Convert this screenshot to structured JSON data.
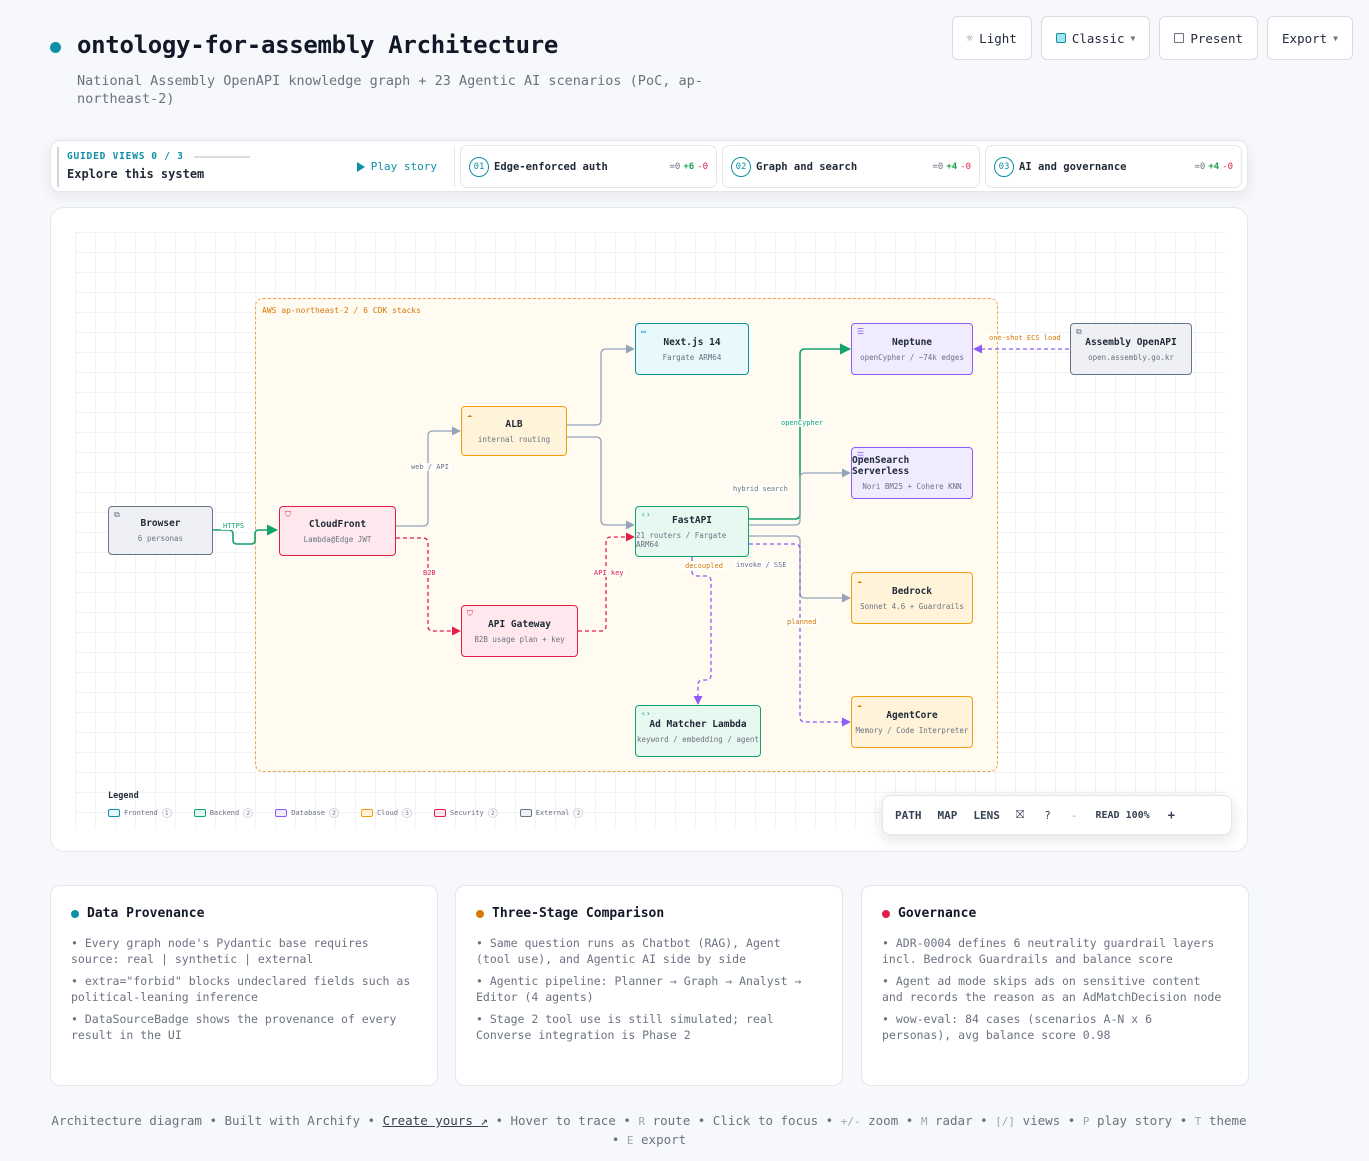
{
  "header": {
    "title": "ontology-for-assembly Architecture",
    "subtitle": "National Assembly OpenAPI knowledge graph + 23 Agentic AI scenarios (PoC, ap-northeast-2)"
  },
  "topbar": {
    "light_label": "Light",
    "classic_label": "Classic",
    "present_label": "Present",
    "export_label": "Export"
  },
  "guided": {
    "kicker": "GUIDED VIEWS",
    "progress": "0 / 3",
    "explore": "Explore this system",
    "play_label": "Play story",
    "views": [
      {
        "num": "01",
        "name": "Edge-enforced auth",
        "eq": "=0",
        "plus": "+6",
        "minus": "-0"
      },
      {
        "num": "02",
        "name": "Graph and search",
        "eq": "=0",
        "plus": "+4",
        "minus": "-0"
      },
      {
        "num": "03",
        "name": "AI and governance",
        "eq": "=0",
        "plus": "+4",
        "minus": "-0"
      }
    ]
  },
  "diagram": {
    "region_label": "AWS ap-northeast-2 / 6 CDK stacks",
    "nodes": {
      "browser": {
        "title": "Browser",
        "sub": "6 personas"
      },
      "cloudfront": {
        "title": "CloudFront",
        "sub": "Lambda@Edge JWT"
      },
      "alb": {
        "title": "ALB",
        "sub": "internal routing"
      },
      "apigw": {
        "title": "API Gateway",
        "sub": "B2B usage plan + key"
      },
      "nextjs": {
        "title": "Next.js 14",
        "sub": "Fargate ARM64"
      },
      "fastapi": {
        "title": "FastAPI",
        "sub": "21 routers / Fargate ARM64"
      },
      "admatcher": {
        "title": "Ad Matcher Lambda",
        "sub": "keyword / embedding / agent"
      },
      "neptune": {
        "title": "Neptune",
        "sub": "openCypher / ~74k edges"
      },
      "opensearch": {
        "title": "OpenSearch Serverless",
        "sub": "Nori BM25 + Cohere KNN"
      },
      "bedrock": {
        "title": "Bedrock",
        "sub": "Sonnet 4.6 + Guardrails"
      },
      "agentcore": {
        "title": "AgentCore",
        "sub": "Memory / Code Interpreter"
      },
      "assembly": {
        "title": "Assembly OpenAPI",
        "sub": "open.assembly.go.kr"
      }
    },
    "edge_labels": {
      "https": "HTTPS",
      "web_api": "web / API",
      "b2b": "B2B",
      "api_key": "API key",
      "opencypher": "openCypher",
      "hybrid_search": "hybrid search",
      "invoke_sse": "invoke / SSE",
      "decoupled": "decoupled",
      "planned": "planned",
      "one_shot": "one-shot ECS load"
    },
    "legend": {
      "title": "Legend",
      "items": [
        {
          "label": "Frontend",
          "count": "1"
        },
        {
          "label": "Backend",
          "count": "2"
        },
        {
          "label": "Database",
          "count": "2"
        },
        {
          "label": "Cloud",
          "count": "3"
        },
        {
          "label": "Security",
          "count": "2"
        },
        {
          "label": "External",
          "count": "2"
        }
      ]
    },
    "colors": {
      "frontend": "#0e8fa6",
      "backend": "#10a36d",
      "database": "#8b5cf6",
      "cloud": "#f59e0b",
      "security": "#e11d48",
      "external": "#64748b"
    }
  },
  "toolbar": {
    "path": "PATH",
    "map": "MAP",
    "lens": "LENS",
    "help": "?",
    "minus": "-",
    "read": "READ 100%",
    "plus": "+"
  },
  "cards": [
    {
      "title": "Data Provenance",
      "color": "#0e8fa6",
      "items": [
        "• Every graph node's Pydantic base requires source: real | synthetic | external",
        "• extra=\"forbid\" blocks undeclared fields such as political-leaning inference",
        "• DataSourceBadge shows the provenance of every result in the UI"
      ]
    },
    {
      "title": "Three-Stage Comparison",
      "color": "#d97706",
      "items": [
        "• Same question runs as Chatbot (RAG), Agent (tool use), and Agentic AI side by side",
        "• Agentic pipeline: Planner → Graph → Analyst → Editor (4 agents)",
        "• Stage 2 tool use is still simulated; real Converse integration is Phase 2"
      ]
    },
    {
      "title": "Governance",
      "color": "#e11d48",
      "items": [
        "• ADR-0004 defines 6 neutrality guardrail layers incl. Bedrock Guardrails and balance score",
        "• Agent ad mode skips ads on sensitive content and records the reason as an AdMatchDecision node",
        "• wow-eval: 84 cases (scenarios A-N x 6 personas), avg balance score 0.98"
      ]
    }
  ],
  "footer": {
    "t1": "Architecture diagram • Built with Archify • ",
    "link": "Create yours ↗",
    "t2": " • Hover to trace • ",
    "k_r": "R",
    "t3": " route • Click to focus • ",
    "k_zoom": "+/-",
    "t4": " zoom • ",
    "k_m": "M",
    "t5": " radar • ",
    "k_views": "[/]",
    "t6": " views • ",
    "k_p": "P",
    "t7": " play story • ",
    "k_t": "T",
    "t8": " theme • ",
    "k_e": "E",
    "t9": " export"
  }
}
